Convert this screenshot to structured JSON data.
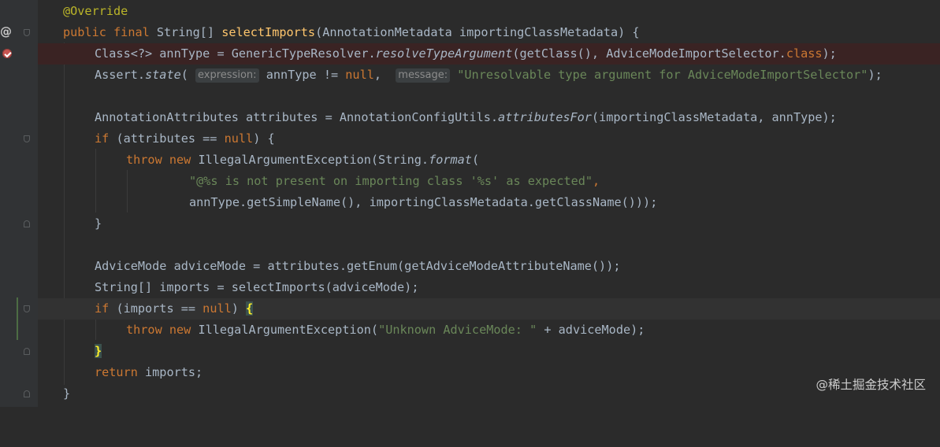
{
  "editor": {
    "gutter": {
      "override_marker": "@",
      "breakpoint_icon": "breakpoint-icon",
      "fold_icon": "fold-icon"
    },
    "lines": [
      {
        "t1": "@Override"
      },
      {
        "t1": "public",
        "t2": " ",
        "t3": "final",
        "t4": " String[] ",
        "t5": "selectImports",
        "t6": "(AnnotationMetadata importingClassMetadata) {"
      },
      {
        "t1": "Class<?> annType = GenericTypeResolver.",
        "t2": "resolveTypeArgument",
        "t3": "(getClass(), AdviceModeImportSelector.",
        "t4": "class",
        "t5": ");"
      },
      {
        "t1": "Assert.",
        "t2": "state",
        "t3": "( ",
        "hint1": "expression:",
        "t4": " annType != ",
        "t5": "null",
        "t6": ",  ",
        "hint2": "message:",
        "t7": " ",
        "t8": "\"Unresolvable type argument for AdviceModeImportSelector\"",
        "t9": ");"
      },
      {},
      {
        "t1": "AnnotationAttributes attributes = AnnotationConfigUtils.",
        "t2": "attributesFor",
        "t3": "(importingClassMetadata, annType);"
      },
      {
        "t1": "if",
        "t2": " (attributes == ",
        "t3": "null",
        "t4": ") {"
      },
      {
        "t1": "throw",
        "t2": " ",
        "t3": "new",
        "t4": " IllegalArgumentException(String.",
        "t5": "format",
        "t6": "("
      },
      {
        "t1": "\"@%s is not present on importing class '%s' as expected\"",
        "t2": ","
      },
      {
        "t1": "annType.getSimpleName(), importingClassMetadata.getClassName()));"
      },
      {
        "t1": "}"
      },
      {},
      {
        "t1": "AdviceMode adviceMode = attributes.getEnum(getAdviceModeAttributeName());"
      },
      {
        "t1": "String[] imports = selectImports(adviceMode);"
      },
      {
        "t1": "if",
        "t2": " (imports == ",
        "t3": "null",
        "t4": ") ",
        "t5": "{"
      },
      {
        "t1": "throw",
        "t2": " ",
        "t3": "new",
        "t4": " IllegalArgumentException(",
        "t5": "\"Unknown AdviceMode: \"",
        "t6": " + adviceMode);"
      },
      {
        "t1": "}"
      },
      {
        "t1": "return",
        "t2": " imports;"
      },
      {
        "t1": "}"
      }
    ]
  },
  "watermark": "@稀土掘金技术社区"
}
